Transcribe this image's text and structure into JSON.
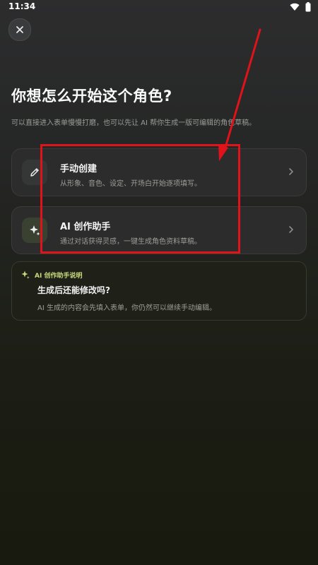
{
  "status_bar": {
    "time": "11:34",
    "icons": [
      "wifi-icon",
      "battery-icon"
    ]
  },
  "header": {
    "close_icon": "close-icon"
  },
  "page": {
    "title": "你想怎么开始这个角色?",
    "subtitle": "可以直接进入表单慢慢打磨，也可以先让 AI 帮你生成一版可编辑的角色草稿。"
  },
  "options": [
    {
      "icon": "pencil-icon",
      "title": "手动创建",
      "description": "从形象、音色、设定、开场白开始逐项填写。"
    },
    {
      "icon": "sparkle-icon",
      "title": "AI 创作助手",
      "description": "通过对话获得灵感，一键生成角色资料草稿。"
    }
  ],
  "info": {
    "icon": "sparkle-icon",
    "tag": "AI 创作助手说明",
    "title": "生成后还能修改吗?",
    "description": "AI 生成的内容会先填入表单，你仍然可以继续手动编辑。"
  },
  "annotation": {
    "color": "#e0121a"
  },
  "colors": {
    "accent": "#c8db7a",
    "background_top": "#2d2d2e",
    "background_bottom": "#181a10"
  }
}
